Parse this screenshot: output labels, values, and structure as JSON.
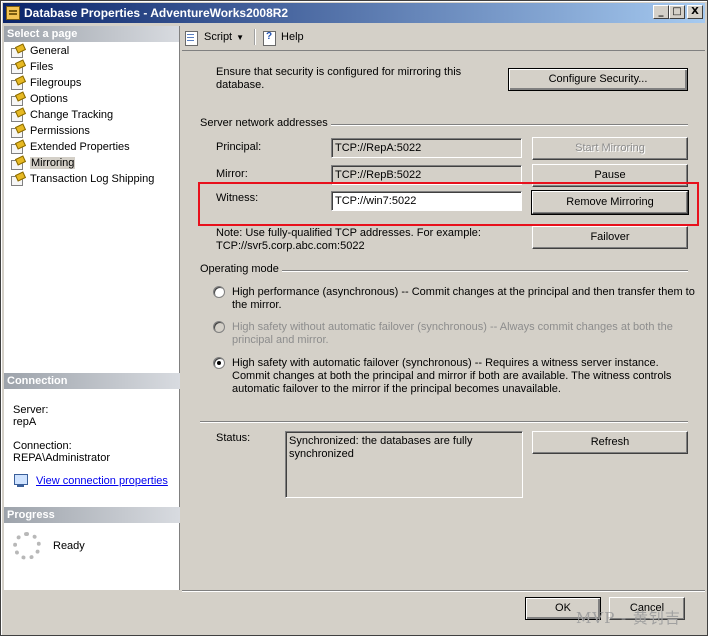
{
  "window": {
    "title": "Database Properties - AdventureWorks2008R2",
    "controls": {
      "minimize": "_",
      "maximize": "□",
      "close": "X"
    }
  },
  "left": {
    "select_header": "Select a page",
    "pages": [
      {
        "label": "General",
        "icon": "page-icon"
      },
      {
        "label": "Files",
        "icon": "page-icon"
      },
      {
        "label": "Filegroups",
        "icon": "page-icon"
      },
      {
        "label": "Options",
        "icon": "page-icon"
      },
      {
        "label": "Change Tracking",
        "icon": "page-icon"
      },
      {
        "label": "Permissions",
        "icon": "page-icon"
      },
      {
        "label": "Extended Properties",
        "icon": "page-icon"
      },
      {
        "label": "Mirroring",
        "icon": "page-icon",
        "selected": true
      },
      {
        "label": "Transaction Log Shipping",
        "icon": "page-icon"
      }
    ],
    "connection_header": "Connection",
    "server_label": "Server:",
    "server_value": "repA",
    "connection_label": "Connection:",
    "connection_value": "REPA\\Administrator",
    "view_link": "View connection properties",
    "progress_header": "Progress",
    "progress_status": "Ready"
  },
  "toolbar": {
    "script_label": "Script",
    "help_label": "Help"
  },
  "mirroring": {
    "security_note": "Ensure that security is configured for mirroring this database.",
    "configure_security": "Configure Security...",
    "server_addresses_header": "Server network addresses",
    "principal_label": "Principal:",
    "principal_value": "TCP://RepA:5022",
    "mirror_label": "Mirror:",
    "mirror_value": "TCP://RepB:5022",
    "witness_label": "Witness:",
    "witness_value": "TCP://win7:5022",
    "start_mirroring": "Start Mirroring",
    "pause": "Pause",
    "remove_mirroring": "Remove Mirroring",
    "failover": "Failover",
    "address_note_1": "Note: Use fully-qualified TCP addresses. For example:",
    "address_note_2": "TCP://svr5.corp.abc.com:5022",
    "operating_mode_header": "Operating mode",
    "mode_high_performance_1": "High performance (asynchronous) -- Commit changes at the principal and then transfer them to",
    "mode_high_performance_2": "the mirror.",
    "mode_high_safety_no_failover_1": "High safety without automatic failover (synchronous) -- Always commit changes at both the",
    "mode_high_safety_no_failover_2": "principal and mirror.",
    "mode_high_safety_failover_1": "High safety with automatic failover (synchronous) -- Requires a witness server instance.",
    "mode_high_safety_failover_2": "Commit changes at both the principal and mirror if both are available. The witness controls",
    "mode_high_safety_failover_3": "automatic failover to the mirror if the principal becomes unavailable.",
    "status_label": "Status:",
    "status_line_1": "Synchronized: the databases are fully",
    "status_line_2": "synchronized",
    "refresh": "Refresh"
  },
  "footer": {
    "ok": "OK",
    "cancel": "Cancel",
    "watermark": "MVP - 黄钊吉"
  },
  "colors": {
    "dialog_face": "#d4d0c8",
    "title_gradient_start": "#0a246a",
    "title_gradient_end": "#a6caf0",
    "highlight_red": "#e8101c",
    "link": "#0000ee"
  }
}
